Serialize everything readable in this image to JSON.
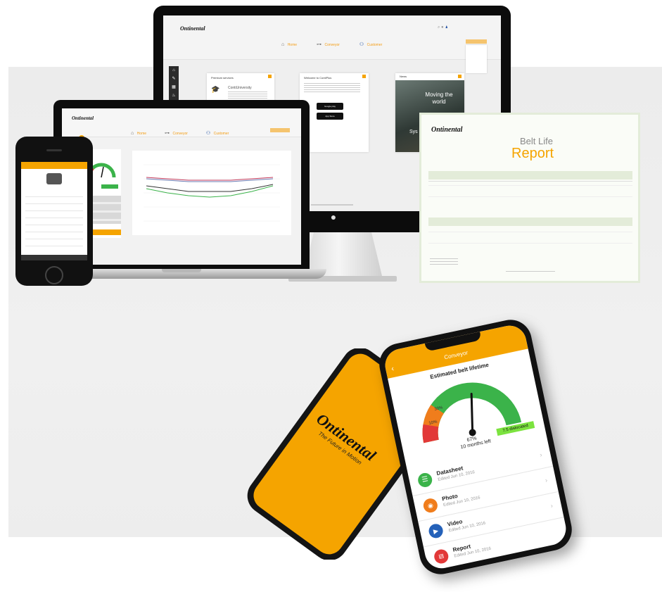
{
  "brand": {
    "logo": "Ontinental",
    "tagline": "The Future in Motion",
    "accent": "#F5A400",
    "dark": "#111111"
  },
  "imac": {
    "nav": [
      "Home",
      "Conveyor",
      "Customer"
    ],
    "cards": {
      "premium_title": "Premium services",
      "premium_name": "ContiUniversity",
      "welcome_title": "Welcome to ContiPlus",
      "google_play": "Google play",
      "app_store": "App Store",
      "news_title": "News",
      "news_headline": "Moving the world",
      "news_sub": "Sys"
    }
  },
  "report": {
    "logo": "Ontinental",
    "title_line1": "Belt Life",
    "title_line2": "Report"
  },
  "phone": {
    "header": "Conveyor",
    "gauge_title": "Estimated belt lifetime",
    "tick_10": "10%",
    "tick_30": "30%",
    "needle_value": "67%",
    "months_left": "10 months left",
    "badge": "7.5 dislocated",
    "items": [
      {
        "title": "Datasheet",
        "sub": "Edited Jun 10, 2016",
        "icon": "list-icon",
        "color": "#3bb34a"
      },
      {
        "title": "Photo",
        "sub": "Edited Jun 10, 2016",
        "icon": "camera-icon",
        "color": "#f07d1c"
      },
      {
        "title": "Video",
        "sub": "Edited Jun 10, 2016",
        "icon": "video-icon",
        "color": "#2461b9"
      },
      {
        "title": "Report",
        "sub": "Edited Jun 10, 2016",
        "icon": "pdf-icon",
        "color": "#e23838"
      }
    ]
  }
}
